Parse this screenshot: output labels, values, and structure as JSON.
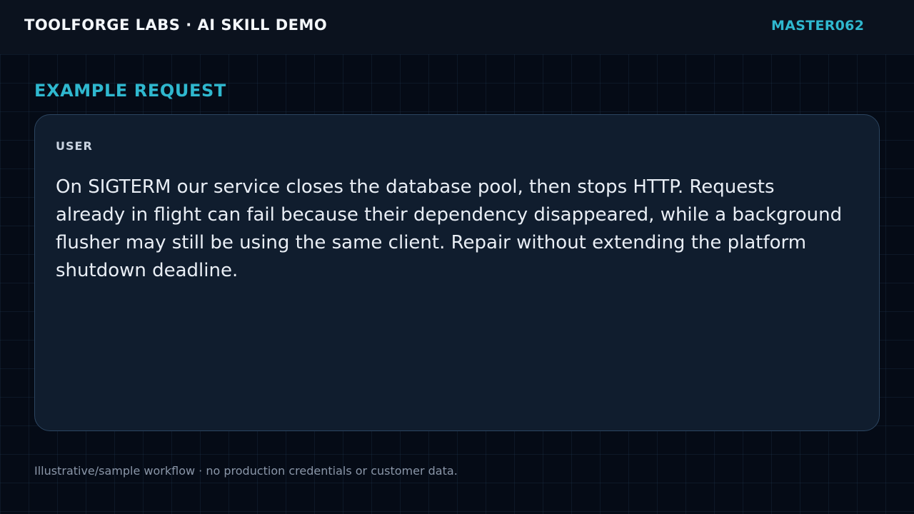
{
  "header": {
    "brand": "TOOLFORGE LABS · AI SKILL DEMO",
    "badge": "MASTER062"
  },
  "section": {
    "title": "EXAMPLE REQUEST"
  },
  "card": {
    "role": "USER",
    "message": "On SIGTERM our service closes the database pool, then stops HTTP. Requests already in flight can fail because their dependency disappeared, while a background flusher may still be using the same client. Repair without extending the platform shutdown deadline."
  },
  "footer": {
    "note": "Illustrative/sample workflow · no production credentials or customer data."
  },
  "colors": {
    "background": "#050b16",
    "topbar": "#0b121e",
    "accent": "#2fb8cf",
    "card": "#101d2e",
    "card_border": "#2c4560"
  }
}
